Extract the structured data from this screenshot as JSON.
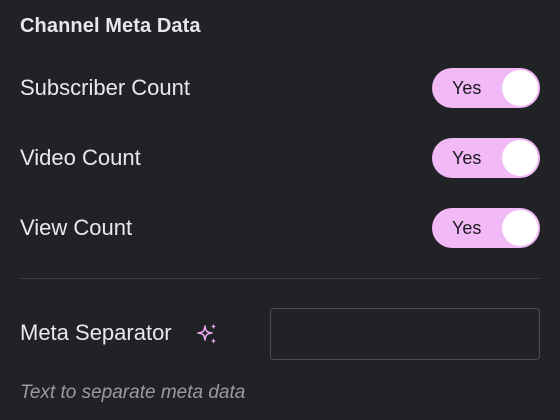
{
  "section": {
    "title": "Channel Meta Data"
  },
  "toggles": [
    {
      "label": "Subscriber Count",
      "state_text": "Yes",
      "on": true
    },
    {
      "label": "Video Count",
      "state_text": "Yes",
      "on": true
    },
    {
      "label": "View Count",
      "state_text": "Yes",
      "on": true
    }
  ],
  "separator_field": {
    "label": "Meta Separator",
    "value": "",
    "help": "Text to separate meta data",
    "icon": "sparkle-icon"
  },
  "colors": {
    "background": "#212226",
    "toggle_on": "#f1b9f5",
    "accent_icon": "#e7a6ee"
  }
}
